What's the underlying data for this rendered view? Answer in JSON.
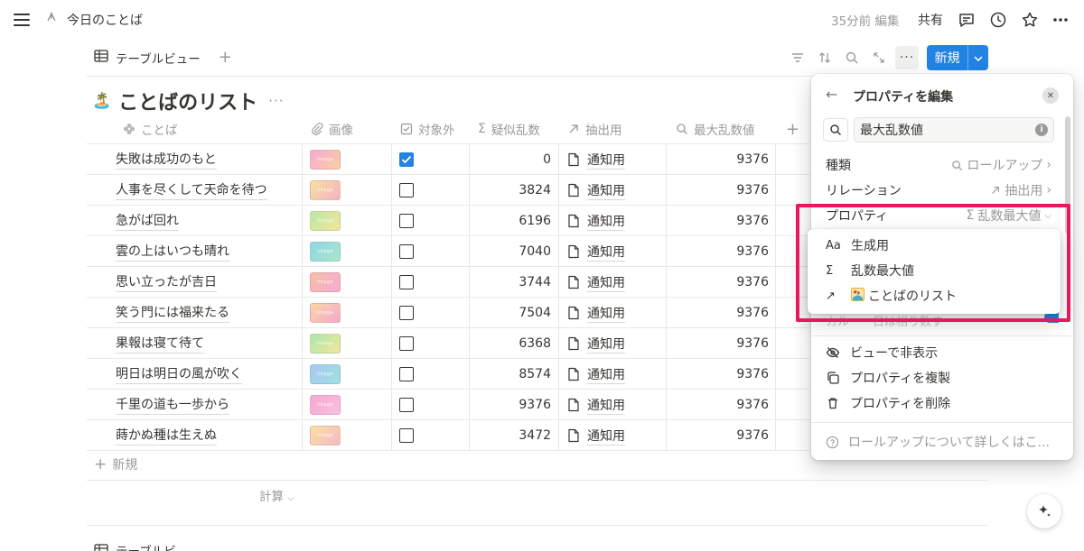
{
  "topbar": {
    "page_title": "今日のことば",
    "edited": "35分前 編集",
    "share": "共有"
  },
  "view": {
    "tab_label": "テーブルビュー",
    "add": "+",
    "more": "···",
    "new_button": "新規"
  },
  "database": {
    "emoji": "🏝️",
    "title": "ことばのリスト",
    "more": "···"
  },
  "table": {
    "headers": {
      "name": "ことば",
      "image": "画像",
      "excluded": "対象外",
      "random": "疑似乱数",
      "extract": "抽出用",
      "max": "最大乱数値",
      "add": "+"
    },
    "rows": [
      {
        "name": "失敗は成功のもと",
        "thumb": "image",
        "thumb_colors": [
          "#f7a8d8",
          "#f9d0a0"
        ],
        "checked": true,
        "random": "0",
        "relation": "通知用",
        "max": "9376"
      },
      {
        "name": "人事を尽くして天命を待つ",
        "thumb": "image",
        "thumb_colors": [
          "#f7e29a",
          "#f5b0c8"
        ],
        "checked": false,
        "random": "3824",
        "relation": "通知用",
        "max": "9376"
      },
      {
        "name": "急がば回れ",
        "thumb": "image",
        "thumb_colors": [
          "#b8e8a8",
          "#f5e59a"
        ],
        "checked": false,
        "random": "6196",
        "relation": "通知用",
        "max": "9376"
      },
      {
        "name": "雲の上はいつも晴れ",
        "thumb": "image",
        "thumb_colors": [
          "#8fd4ea",
          "#a8e8c8"
        ],
        "checked": false,
        "random": "7040",
        "relation": "通知用",
        "max": "9376"
      },
      {
        "name": "思い立ったが吉日",
        "thumb": "image",
        "thumb_colors": [
          "#f5c0a0",
          "#f7a8d8"
        ],
        "checked": false,
        "random": "3744",
        "relation": "通知用",
        "max": "9376"
      },
      {
        "name": "笑う門には福来たる",
        "thumb": "image",
        "thumb_colors": [
          "#f9d6a8",
          "#f5a8c8"
        ],
        "checked": false,
        "random": "7504",
        "relation": "通知用",
        "max": "9376"
      },
      {
        "name": "果報は寝て待て",
        "thumb": "image",
        "thumb_colors": [
          "#a8e8b0",
          "#f5e59a"
        ],
        "checked": false,
        "random": "6368",
        "relation": "通知用",
        "max": "9376"
      },
      {
        "name": "明日は明日の風が吹く",
        "thumb": "image",
        "thumb_colors": [
          "#a8c8f0",
          "#9ee0e0"
        ],
        "checked": false,
        "random": "8574",
        "relation": "通知用",
        "max": "9376"
      },
      {
        "name": "千里の道も一歩から",
        "thumb": "image",
        "thumb_colors": [
          "#f5a8d0",
          "#f9c0e0"
        ],
        "checked": false,
        "random": "9376",
        "relation": "通知用",
        "max": "9376"
      },
      {
        "name": "蒔かぬ種は生えぬ",
        "thumb": "image",
        "thumb_colors": [
          "#f9e0a0",
          "#f5b8c8"
        ],
        "checked": false,
        "random": "3472",
        "relation": "通知用",
        "max": "9376"
      }
    ],
    "new_row": "新規",
    "calc": "計算",
    "second_table": "テーブルビ"
  },
  "panel": {
    "title": "プロパティを編集",
    "name_value": "最大乱数値",
    "type_label": "種類",
    "type_value": "ロールアップ",
    "relation_label": "リレーション",
    "relation_value": "抽出用",
    "property_label": "プロパティ",
    "property_value": "乱数最大値",
    "peek_text": "カルーー日は相り数す",
    "actions": {
      "hide": "ビューで非表示",
      "duplicate": "プロパティを複製",
      "delete": "プロパティを削除"
    },
    "help": "ロールアップについて詳しくはこ..."
  },
  "dropdown": {
    "items": [
      {
        "icon": "Aa",
        "label": "生成用"
      },
      {
        "icon": "Σ",
        "label": "乱数最大値"
      },
      {
        "icon": "↗",
        "label": "ことばのリスト"
      }
    ]
  },
  "colors": {
    "accent": "#2383e2",
    "highlight": "#e8185d",
    "muted": "#9b9a97",
    "text": "#37352f"
  }
}
